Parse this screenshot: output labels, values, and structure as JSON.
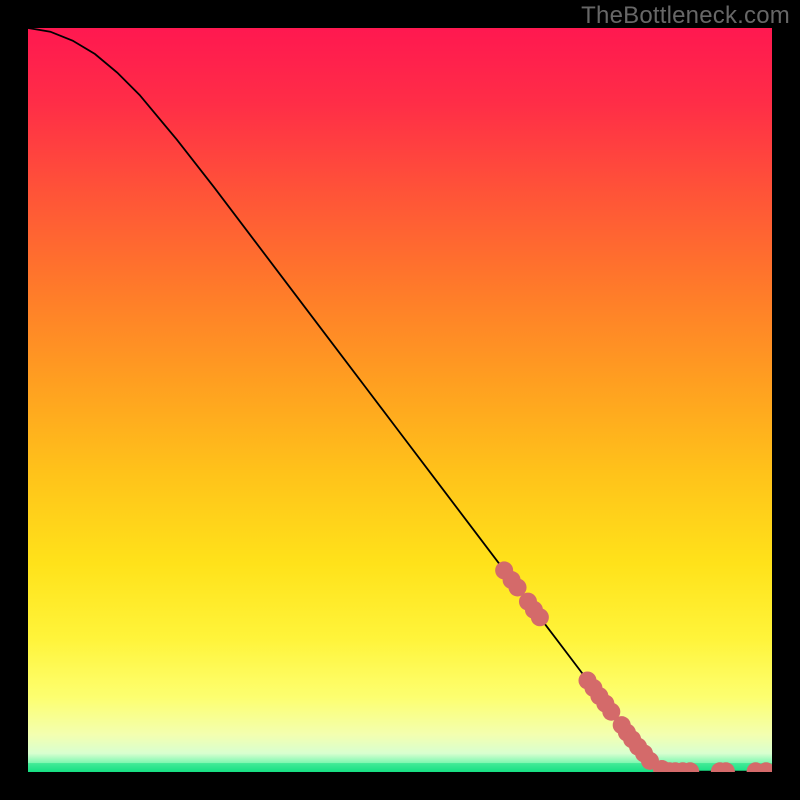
{
  "watermark": "TheBottleneck.com",
  "chart_data": {
    "type": "line",
    "title": "",
    "xlabel": "",
    "ylabel": "",
    "xlim": [
      0,
      100
    ],
    "ylim": [
      0,
      100
    ],
    "curve": [
      {
        "x": 0,
        "y": 100.0
      },
      {
        "x": 3,
        "y": 99.5
      },
      {
        "x": 6,
        "y": 98.3
      },
      {
        "x": 9,
        "y": 96.5
      },
      {
        "x": 12,
        "y": 94.0
      },
      {
        "x": 15,
        "y": 91.0
      },
      {
        "x": 20,
        "y": 85.0
      },
      {
        "x": 25,
        "y": 78.6
      },
      {
        "x": 30,
        "y": 72.0
      },
      {
        "x": 35,
        "y": 65.4
      },
      {
        "x": 40,
        "y": 58.8
      },
      {
        "x": 45,
        "y": 52.2
      },
      {
        "x": 50,
        "y": 45.6
      },
      {
        "x": 55,
        "y": 39.0
      },
      {
        "x": 60,
        "y": 32.4
      },
      {
        "x": 65,
        "y": 25.8
      },
      {
        "x": 70,
        "y": 19.2
      },
      {
        "x": 75,
        "y": 12.6
      },
      {
        "x": 80,
        "y": 6.0
      },
      {
        "x": 84,
        "y": 1.0
      },
      {
        "x": 86,
        "y": 0.1
      },
      {
        "x": 90,
        "y": 0.05
      },
      {
        "x": 95,
        "y": 0.05
      },
      {
        "x": 100,
        "y": 0.05
      }
    ],
    "scatter": [
      {
        "x": 64.0,
        "y": 27.1
      },
      {
        "x": 65.0,
        "y": 25.8
      },
      {
        "x": 65.8,
        "y": 24.8
      },
      {
        "x": 67.2,
        "y": 22.9
      },
      {
        "x": 68.0,
        "y": 21.8
      },
      {
        "x": 68.8,
        "y": 20.8
      },
      {
        "x": 75.2,
        "y": 12.3
      },
      {
        "x": 76.0,
        "y": 11.3
      },
      {
        "x": 76.8,
        "y": 10.2
      },
      {
        "x": 77.6,
        "y": 9.2
      },
      {
        "x": 78.4,
        "y": 8.1
      },
      {
        "x": 79.8,
        "y": 6.3
      },
      {
        "x": 80.5,
        "y": 5.3
      },
      {
        "x": 81.2,
        "y": 4.4
      },
      {
        "x": 82.0,
        "y": 3.4
      },
      {
        "x": 82.8,
        "y": 2.5
      },
      {
        "x": 83.6,
        "y": 1.5
      },
      {
        "x": 85.2,
        "y": 0.4
      },
      {
        "x": 86.2,
        "y": 0.1
      },
      {
        "x": 87.0,
        "y": 0.1
      },
      {
        "x": 88.0,
        "y": 0.1
      },
      {
        "x": 89.0,
        "y": 0.1
      },
      {
        "x": 93.0,
        "y": 0.1
      },
      {
        "x": 93.8,
        "y": 0.1
      },
      {
        "x": 97.8,
        "y": 0.1
      },
      {
        "x": 99.2,
        "y": 0.1
      }
    ],
    "green_band": {
      "from": 0.0,
      "to": 1.2
    },
    "marker_color": "#d46a6a",
    "marker_radius_px": 9
  }
}
